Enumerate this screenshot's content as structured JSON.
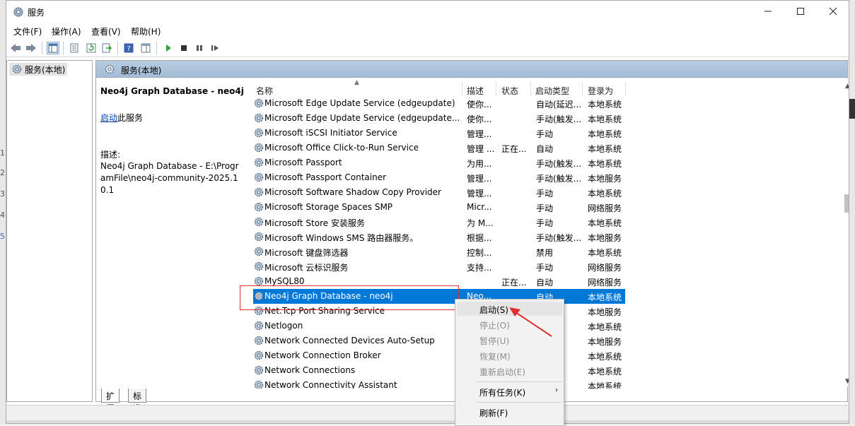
{
  "window": {
    "title": "服务"
  },
  "menu": [
    "文件(F)",
    "操作(A)",
    "查看(V)",
    "帮助(H)"
  ],
  "tree": {
    "root_label": "服务(本地)"
  },
  "main_header": "服务(本地)",
  "detail": {
    "service_title": "Neo4j Graph Database - neo4j",
    "start_link": "启动",
    "start_suffix": "此服务",
    "desc_label": "描述:",
    "desc_text": "Neo4j Graph Database - E:\\ProgramFile\\neo4j-community-2025.10.1"
  },
  "columns": [
    "名称",
    "描述",
    "状态",
    "启动类型",
    "登录为"
  ],
  "rows": [
    {
      "name": "Microsoft Edge Update Service (edgeupdate)",
      "desc": "使你...",
      "status": "",
      "startup": "自动(延迟...",
      "logon": "本地系统"
    },
    {
      "name": "Microsoft Edge Update Service (edgeupdate...",
      "desc": "使你...",
      "status": "",
      "startup": "手动(触发...",
      "logon": "本地系统"
    },
    {
      "name": "Microsoft iSCSI Initiator Service",
      "desc": "管理...",
      "status": "",
      "startup": "手动",
      "logon": "本地系统"
    },
    {
      "name": "Microsoft Office Click-to-Run Service",
      "desc": "管理 ...",
      "status": "正在...",
      "startup": "自动",
      "logon": "本地系统"
    },
    {
      "name": "Microsoft Passport",
      "desc": "为用...",
      "status": "",
      "startup": "手动(触发...",
      "logon": "本地系统"
    },
    {
      "name": "Microsoft Passport Container",
      "desc": "管理...",
      "status": "",
      "startup": "手动(触发...",
      "logon": "本地服务"
    },
    {
      "name": "Microsoft Software Shadow Copy Provider",
      "desc": "管理...",
      "status": "",
      "startup": "手动",
      "logon": "本地系统"
    },
    {
      "name": "Microsoft Storage Spaces SMP",
      "desc": "Micr...",
      "status": "",
      "startup": "手动",
      "logon": "网络服务"
    },
    {
      "name": "Microsoft Store 安装服务",
      "desc": "为 M...",
      "status": "",
      "startup": "手动",
      "logon": "本地系统"
    },
    {
      "name": "Microsoft Windows SMS 路由器服务。",
      "desc": "根据...",
      "status": "",
      "startup": "手动(触发...",
      "logon": "本地服务"
    },
    {
      "name": "Microsoft 键盘筛选器",
      "desc": "控制...",
      "status": "",
      "startup": "禁用",
      "logon": "本地系统"
    },
    {
      "name": "Microsoft 云标识服务",
      "desc": "支持...",
      "status": "",
      "startup": "手动",
      "logon": "网络服务"
    },
    {
      "name": "MySQL80",
      "desc": "",
      "status": "正在...",
      "startup": "自动",
      "logon": "网络服务"
    },
    {
      "name": "Neo4j Graph Database - neo4j",
      "desc": "Neo...",
      "status": "",
      "startup": "自动",
      "logon": "本地系统"
    },
    {
      "name": "Net.Tcp Port Sharing Service",
      "desc": "",
      "status": "",
      "startup": "",
      "logon": "本地服务"
    },
    {
      "name": "Netlogon",
      "desc": "",
      "status": "",
      "startup": "",
      "logon": "本地系统"
    },
    {
      "name": "Network Connected Devices Auto-Setup",
      "desc": "",
      "status": "",
      "startup": "",
      "logon": "本地服务"
    },
    {
      "name": "Network Connection Broker",
      "desc": "",
      "status": "",
      "startup": "",
      "logon": "本地系统"
    },
    {
      "name": "Network Connections",
      "desc": "",
      "status": "",
      "startup": "",
      "logon": "本地系统"
    },
    {
      "name": "Network Connectivity Assistant",
      "desc": "",
      "status": "",
      "startup": "",
      "logon": "本地系统"
    }
  ],
  "selected_row": 13,
  "tabs": [
    "扩展",
    "标准"
  ],
  "context_menu": {
    "start": "启动(S)",
    "stop": "停止(O)",
    "pause": "暂停(U)",
    "resume": "恢复(M)",
    "restart": "重新启动(E)",
    "all_tasks": "所有任务(K)",
    "refresh": "刷新(F)"
  },
  "colors": {
    "selection": "#0078d7",
    "annotation": "#e03030",
    "link": "#0645ad"
  }
}
